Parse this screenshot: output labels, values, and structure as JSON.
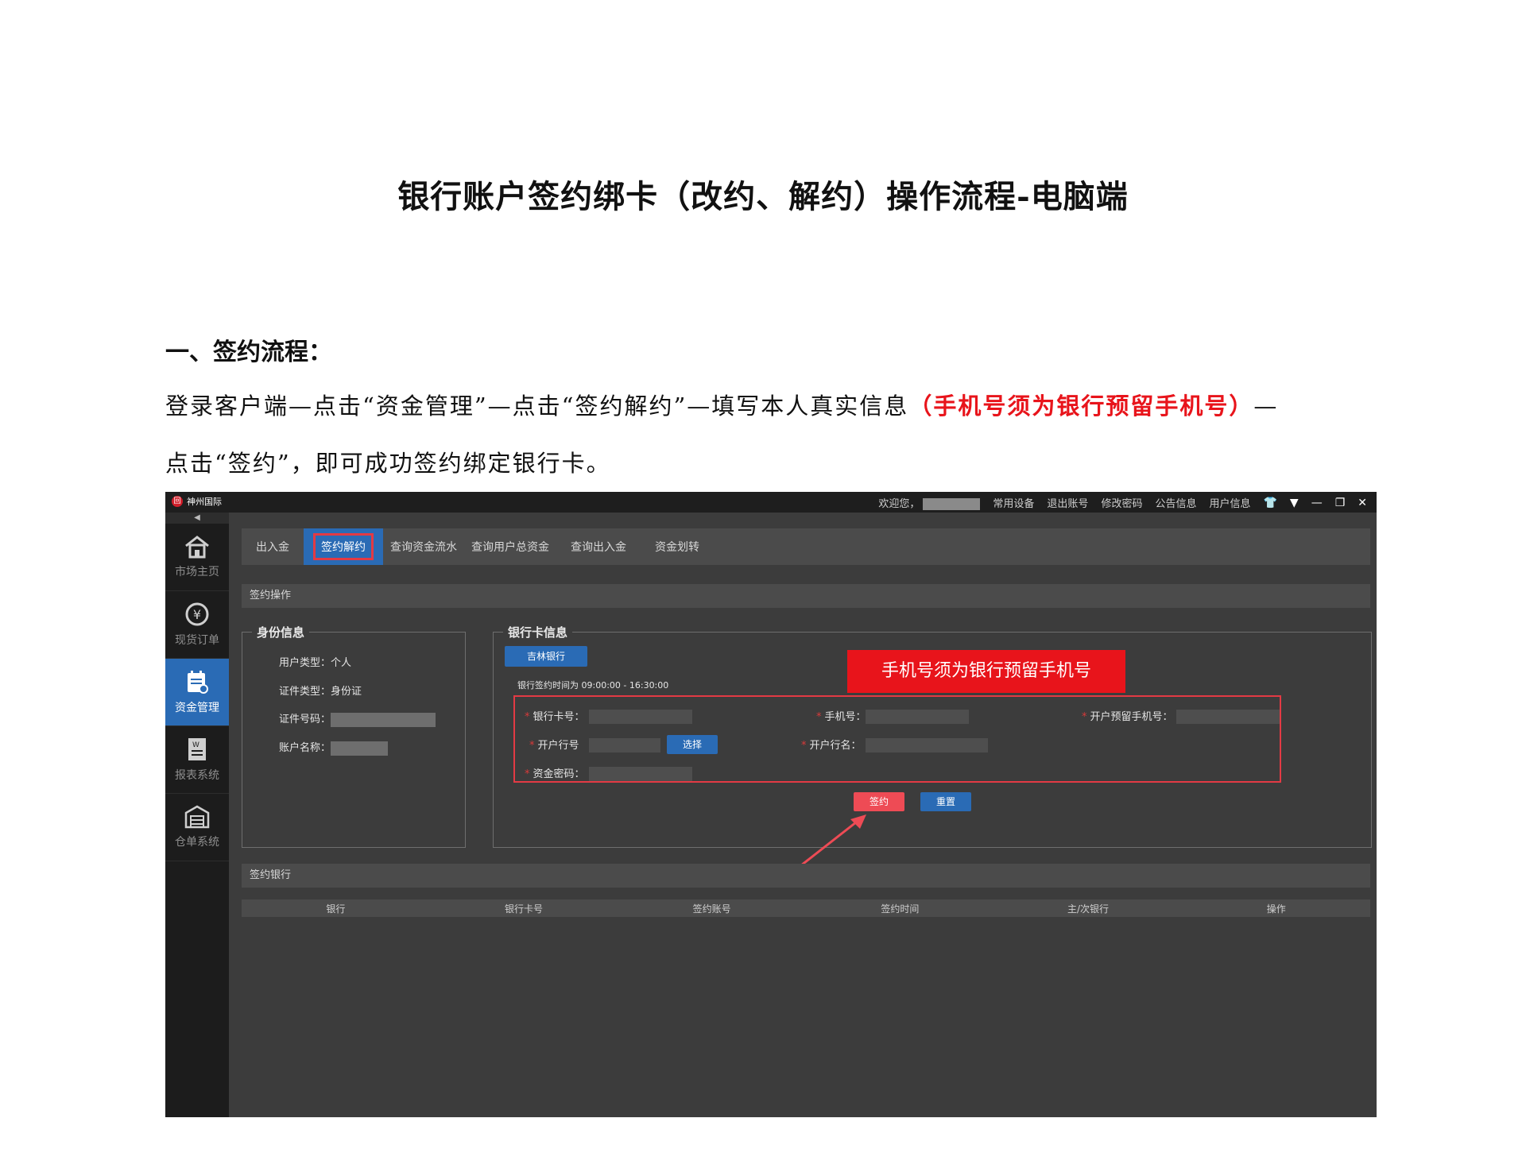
{
  "doc": {
    "title": "银行账户签约绑卡（改约、解约）操作流程-电脑端",
    "section_heading": "一、签约流程：",
    "para_line1_a": "登录客户端—点击“资金管理”—点击“签约解约”—填写本人真实信息",
    "para_line1_red": "（手机号须为银行预留手机号）",
    "para_line1_b": "—",
    "para_line2": "点击“签约”，即可成功签约绑定银行卡。"
  },
  "app": {
    "brand": "神州国际",
    "welcome": "欢迎您，",
    "top_links": [
      "常用设备",
      "退出账号",
      "修改密码",
      "公告信息",
      "用户信息"
    ],
    "collapse_arrow": "◀",
    "sidebar": [
      {
        "label": "市场主页",
        "icon": "home-icon"
      },
      {
        "label": "现货订单",
        "icon": "yen-icon"
      },
      {
        "label": "资金管理",
        "icon": "calendar-money-icon",
        "active": true
      },
      {
        "label": "报表系统",
        "icon": "report-icon"
      },
      {
        "label": "仓单系统",
        "icon": "warehouse-icon"
      }
    ],
    "tabs": [
      "出入金",
      "签约解约",
      "查询资金流水",
      "查询用户总资金",
      "查询出入金",
      "资金划转"
    ],
    "active_tab": "签约解约",
    "sign_panel_title": "签约操作",
    "identity": {
      "legend": "身份信息",
      "user_type_label": "用户类型：",
      "user_type_value": "个人",
      "cert_type_label": "证件类型：",
      "cert_type_value": "身份证",
      "cert_no_label": "证件号码：",
      "account_name_label": "账户名称："
    },
    "bank_card": {
      "legend": "银行卡信息",
      "bank_button": "吉林银行",
      "time_note": "银行签约时间为 09:00:00 - 16:30:00",
      "card_no_label": "银行卡号：",
      "phone_label": "手机号：",
      "reserved_phone_label": "开户预留手机号：",
      "branch_no_label": "开户行号",
      "select_button": "选择",
      "branch_name_label": "开户行名：",
      "fund_password_label": "资金密码：",
      "required_mark": "*"
    },
    "callout": "手机号须为银行预留手机号",
    "sign_button": "签约",
    "reset_button": "重置",
    "signed_panel_title": "签约银行",
    "table_headers": [
      "银行",
      "银行卡号",
      "签约账号",
      "签约时间",
      "主/次银行",
      "操作"
    ],
    "colors": {
      "accent_blue": "#2a6bb5",
      "highlight_red": "#e33a44",
      "callout_red": "#e8141b"
    }
  }
}
